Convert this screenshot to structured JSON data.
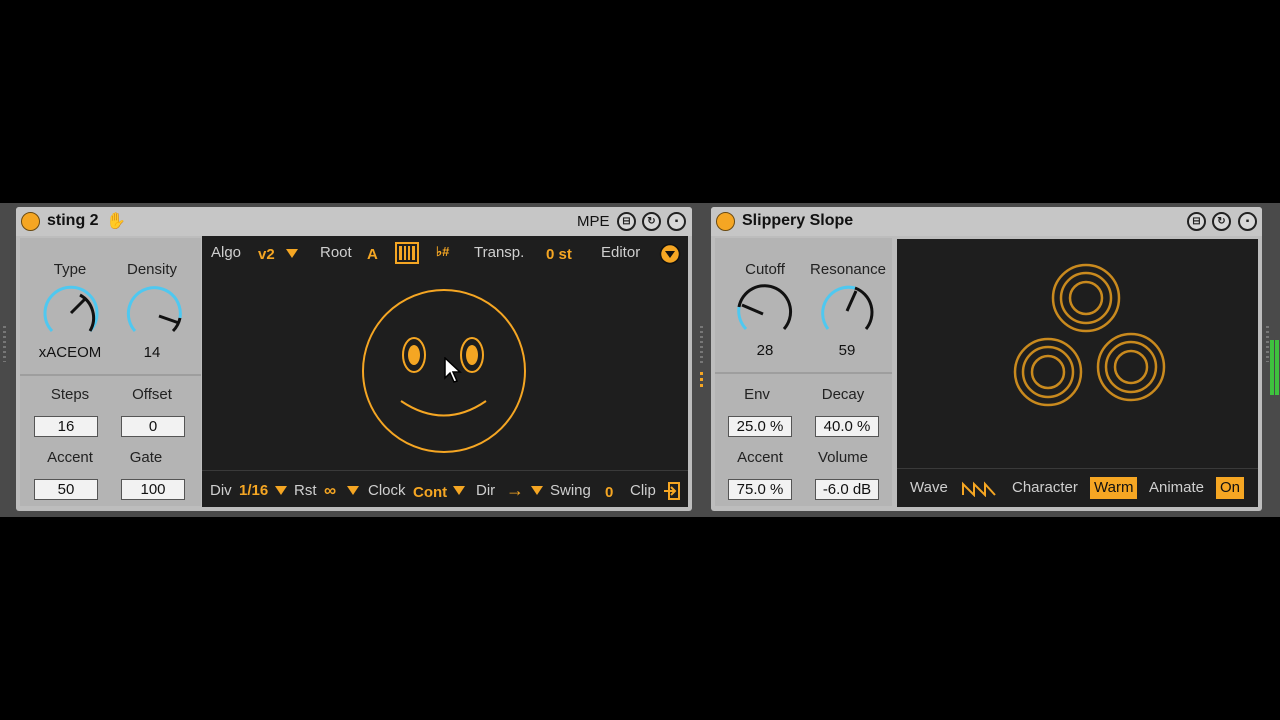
{
  "colors": {
    "accent": "#f5a623",
    "knob_arc": "#4fc8f0",
    "hand_icon": "#2d7fe6"
  },
  "device1": {
    "title": "sting 2",
    "mpe_label": "MPE",
    "hand_icon": "hand-icon",
    "knobs": [
      {
        "label": "Type",
        "value": "xACEOM"
      },
      {
        "label": "Density",
        "value": "14"
      }
    ],
    "params": {
      "steps": {
        "label": "Steps",
        "value": "16"
      },
      "offset": {
        "label": "Offset",
        "value": "0"
      },
      "accent": {
        "label": "Accent",
        "value": "50"
      },
      "gate": {
        "label": "Gate",
        "value": "100"
      }
    },
    "top_bar": {
      "algo_label": "Algo",
      "algo_value": "v2",
      "root_label": "Root",
      "root_value": "A",
      "accidental": "♭#",
      "transp_label": "Transp.",
      "transp_value": "0 st",
      "editor_label": "Editor"
    },
    "bottom_bar": {
      "div_label": "Div",
      "div_value": "1/16",
      "rst_label": "Rst",
      "rst_value": "∞",
      "clock_label": "Clock",
      "clock_value": "Cont",
      "dir_label": "Dir",
      "dir_value": "→",
      "swing_label": "Swing",
      "swing_value": "0",
      "clip_label": "Clip"
    }
  },
  "device2": {
    "title": "Slippery Slope",
    "knobs": [
      {
        "label": "Cutoff",
        "value": "28"
      },
      {
        "label": "Resonance",
        "value": "59"
      }
    ],
    "params": {
      "env": {
        "label": "Env",
        "value": "25.0 %"
      },
      "decay": {
        "label": "Decay",
        "value": "40.0 %"
      },
      "accent": {
        "label": "Accent",
        "value": "75.0 %"
      },
      "volume": {
        "label": "Volume",
        "value": "-6.0 dB"
      }
    },
    "bottom_bar": {
      "wave_label": "Wave",
      "character_label": "Character",
      "character_value": "Warm",
      "animate_label": "Animate",
      "animate_value": "On"
    }
  }
}
